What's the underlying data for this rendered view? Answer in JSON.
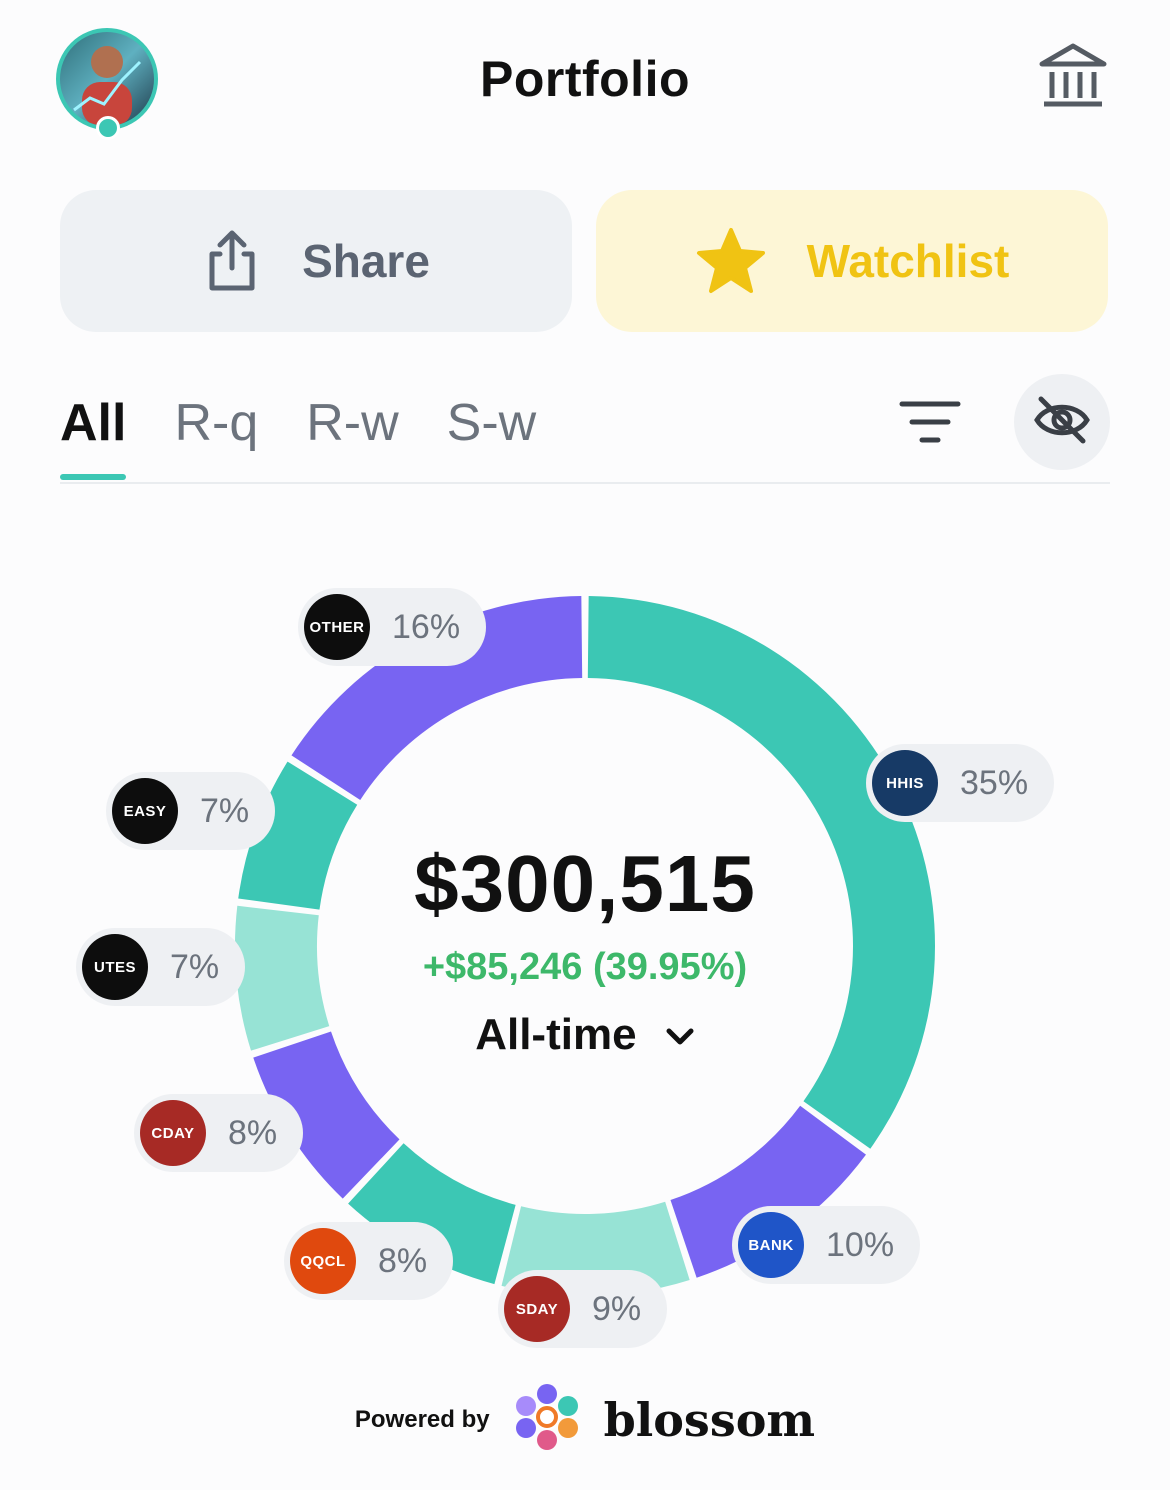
{
  "header": {
    "title": "Portfolio"
  },
  "actions": {
    "share_label": "Share",
    "watchlist_label": "Watchlist"
  },
  "tabs": [
    {
      "label": "All",
      "active": true
    },
    {
      "label": "R-q",
      "active": false
    },
    {
      "label": "R-w",
      "active": false
    },
    {
      "label": "S-w",
      "active": false
    }
  ],
  "summary": {
    "value": "$300,515",
    "change": "+$85,246 (39.95%)",
    "period": "All-time"
  },
  "holdings": [
    {
      "ticker": "HHIS",
      "pct": "35%",
      "value": 35,
      "segment_color": "#3cc7b4",
      "badge_color": "#173a66"
    },
    {
      "ticker": "BANK",
      "pct": "10%",
      "value": 10,
      "segment_color": "#7864f2",
      "badge_color": "#1f55c8"
    },
    {
      "ticker": "SDAY",
      "pct": "9%",
      "value": 9,
      "segment_color": "#97e3d5",
      "badge_color": "#a72a25"
    },
    {
      "ticker": "QQCL",
      "pct": "8%",
      "value": 8,
      "segment_color": "#3cc7b4",
      "badge_color": "#e0490e"
    },
    {
      "ticker": "CDAY",
      "pct": "8%",
      "value": 8,
      "segment_color": "#7864f2",
      "badge_color": "#a72a25"
    },
    {
      "ticker": "UTES",
      "pct": "7%",
      "value": 7,
      "segment_color": "#97e3d5",
      "badge_color": "#0d0d0d"
    },
    {
      "ticker": "EASY",
      "pct": "7%",
      "value": 7,
      "segment_color": "#3cc7b4",
      "badge_color": "#0d0d0d"
    },
    {
      "ticker": "OTHER",
      "pct": "16%",
      "value": 16,
      "segment_color": "#7864f2",
      "badge_color": "#0d0d0d"
    }
  ],
  "footer": {
    "powered_by": "Powered by",
    "brand": "blossom"
  },
  "colors": {
    "accent": "#3cc7b4",
    "positive": "#3db86a",
    "watchlist": "#f0c313"
  }
}
